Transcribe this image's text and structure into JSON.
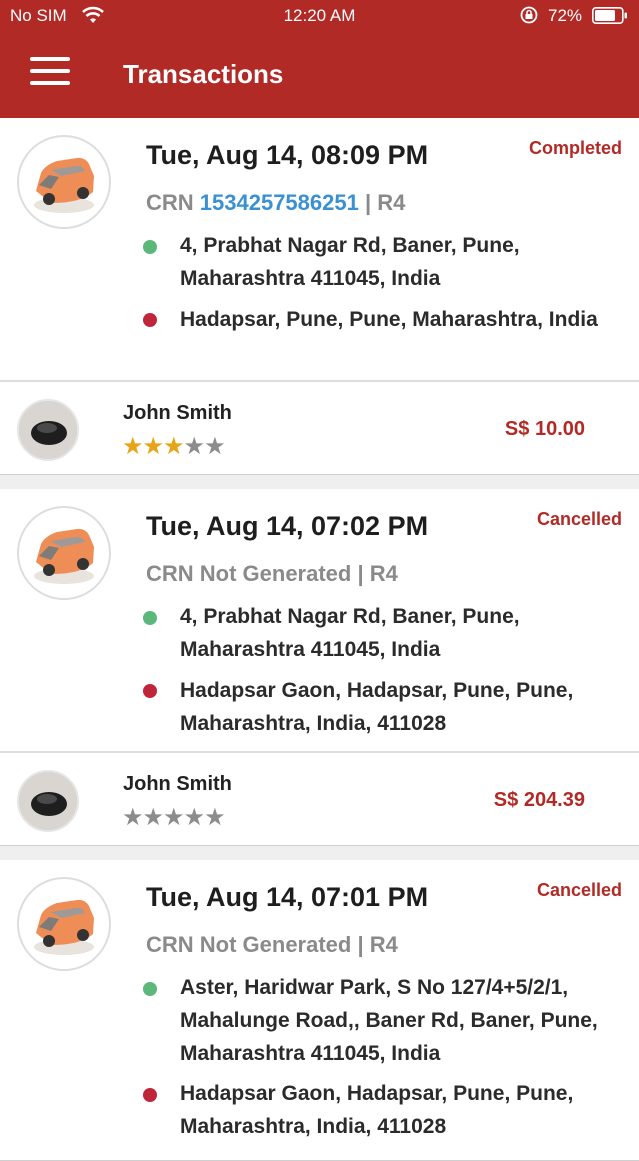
{
  "status_bar": {
    "carrier": "No SIM",
    "time": "12:20 AM",
    "battery": "72%"
  },
  "header": {
    "title": "Transactions"
  },
  "transactions": [
    {
      "datetime": "Tue, Aug 14, 08:09 PM",
      "status": "Completed",
      "crn_label": "CRN ",
      "crn_number": "1534257586251",
      "crn_suffix": " | R4",
      "pickup": "4, Prabhat Nagar Rd, Baner, Pune, Maharashtra 411045, India",
      "drop": "Hadapsar, Pune, Pune, Maharashtra, India",
      "driver_name": "John Smith",
      "rating": 3,
      "amount": "S$ 10.00"
    },
    {
      "datetime": "Tue, Aug 14, 07:02 PM",
      "status": "Cancelled",
      "crn_label": "CRN Not Generated | R4",
      "pickup": "4, Prabhat Nagar Rd, Baner, Pune, Maharashtra 411045, India",
      "drop": "Hadapsar Gaon, Hadapsar, Pune, Pune, Maharashtra, India, 411028",
      "driver_name": "John Smith",
      "rating": 0,
      "amount": "S$ 204.39"
    },
    {
      "datetime": "Tue, Aug 14, 07:01 PM",
      "status": "Cancelled",
      "crn_label": "CRN Not Generated | R4",
      "pickup": "Aster, Haridwar Park, S No 127/4+5/2/1, Mahalunge Road,, Baner Rd, Baner, Pune, Maharashtra 411045, India",
      "drop": "Hadapsar Gaon, Hadapsar, Pune, Pune, Maharashtra, India, 411028"
    }
  ],
  "colors": {
    "brand": "#b22a26",
    "crn_link": "#3a90d0",
    "star": "#e8a317"
  }
}
